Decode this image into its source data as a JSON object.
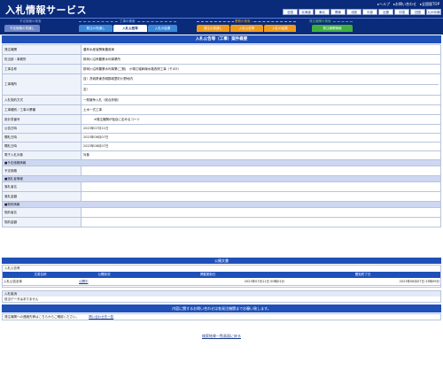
{
  "header": {
    "title": "入札情報サービス",
    "links": [
      "ヘルプ",
      "お問い合わせ",
      "全国版TOP"
    ],
    "regions": [
      "全国",
      "北海道",
      "東北",
      "関東",
      "北陸",
      "中部",
      "近畿",
      "中国",
      "四国",
      "九州沖縄"
    ]
  },
  "nav": {
    "groups": [
      {
        "label": "予定価格の検索",
        "color": "#7a8fc8",
        "tabs": [
          {
            "label": "予定価格の見通し",
            "bg": "#6f86c6",
            "fg": "#ffffff"
          }
        ]
      },
      {
        "label": "工事の検索",
        "color": "#5aa0e0",
        "tabs": [
          {
            "label": "発注の見通し",
            "bg": "#3a88d8",
            "fg": "#ffffff"
          },
          {
            "label": "入札公告等",
            "bg": "#ffffff",
            "fg": "#1a3a8a"
          },
          {
            "label": "入札の結果",
            "bg": "#3a88d8",
            "fg": "#ffffff"
          }
        ]
      },
      {
        "label": "業務の検索",
        "color": "#f0a020",
        "tabs": [
          {
            "label": "発注の見通し",
            "bg": "#ee9a1a",
            "fg": "#ffffff"
          },
          {
            "label": "入札公告等",
            "bg": "#ee9a1a",
            "fg": "#ffffff"
          },
          {
            "label": "入札の結果",
            "bg": "#ee9a1a",
            "fg": "#ffffff"
          }
        ]
      },
      {
        "label": "発注機関の検索",
        "color": "#40b040",
        "tabs": [
          {
            "label": "発注機関情報",
            "bg": "#3fae3f",
            "fg": "#ffffff"
          }
        ]
      }
    ]
  },
  "main": {
    "title": "入札公告等（工事）案件概要",
    "rows": [
      {
        "label": "発注機関",
        "value": "農林水産省関東農政局"
      },
      {
        "label": "担当部・事務所",
        "value": "那珂川沿岸農業水利事業所"
      },
      {
        "label": "工事名称",
        "value": "那珂川沿岸農業水利事業(二期)　小場江堰幹線水路改修工事（その5）"
      },
      {
        "label": "工事場所",
        "value": "自）茨城県東茨城郡城里町小野地内",
        "value2": "至）"
      },
      {
        "label": "入札契約方式",
        "value": "一般競争入札（総合評価）"
      },
      {
        "label": "工事種別／工事の業種",
        "value": "土木一式工事"
      },
      {
        "label": "設計書番号",
        "value": "※発注機関が独自に定めるコード"
      },
      {
        "label": "公告日時",
        "value": "2023年07月11日"
      },
      {
        "label": "開札日時",
        "value": "2023年08月07日"
      },
      {
        "label": "開札日時",
        "value": "2023年08月07日"
      },
      {
        "label": "電子入札対象",
        "value": "対象"
      }
    ],
    "sec_price": "■予定価格情報",
    "price_label": "予定価格",
    "sec_winner": "■落札者情報",
    "winner_rows": [
      "落札者名",
      "落札金額"
    ],
    "sec_contract": "■契約情報",
    "contract_rows": [
      "契約者名",
      "契約金額"
    ]
  },
  "publications": {
    "bar_title": "公開文書",
    "section_label": "入札公告等",
    "columns": [
      "文書名称",
      "公開状況",
      "掲載更新日",
      "閲覧終了日"
    ],
    "row": {
      "name": "入札公告全体",
      "status": "公開中",
      "updated": "2023年07月11日 00時01分",
      "end": "2023年08月07日 23時59分"
    }
  },
  "cancel": {
    "header": "入札取消",
    "body": "該当データはありません"
  },
  "contact": {
    "bar": "内容に関するお問い合わせは各発注機関までお願い致します。",
    "text": "発注機関への連絡先等はこちらからご確認ください。",
    "link": "問い合わせ先一覧"
  },
  "back_link": "検索結果一覧画面に戻る"
}
